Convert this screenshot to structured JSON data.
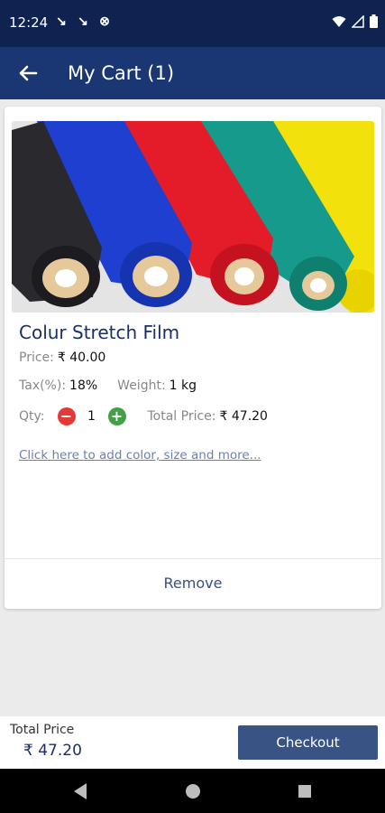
{
  "status_bar": {
    "time": "12:24"
  },
  "app_bar": {
    "title": "My Cart (1)"
  },
  "product": {
    "name": "Colur Stretch Film",
    "price_label": "Price:",
    "price_value": "₹ 40.00",
    "tax_label": "Tax(%):",
    "tax_value": "18%",
    "weight_label": "Weight:",
    "weight_value": "1 kg",
    "qty_label": "Qty:",
    "qty_value": "1",
    "total_price_label": "Total Price:",
    "total_price_value": "₹ 47.20",
    "add_options_link": "Click here to add color, size and more...",
    "remove_label": "Remove",
    "roll_colors": [
      "#2a2a2e",
      "#1f3fd0",
      "#e41c2a",
      "#159a8c",
      "#f2e10a"
    ]
  },
  "bottom_bar": {
    "total_label": "Total Price",
    "total_value": "₹ 47.20",
    "checkout_label": "Checkout"
  },
  "colors": {
    "status_bar": "#0f2350",
    "app_bar": "#1a3673",
    "checkout": "#3a5385",
    "minus": "#e53935",
    "plus": "#43a047"
  }
}
